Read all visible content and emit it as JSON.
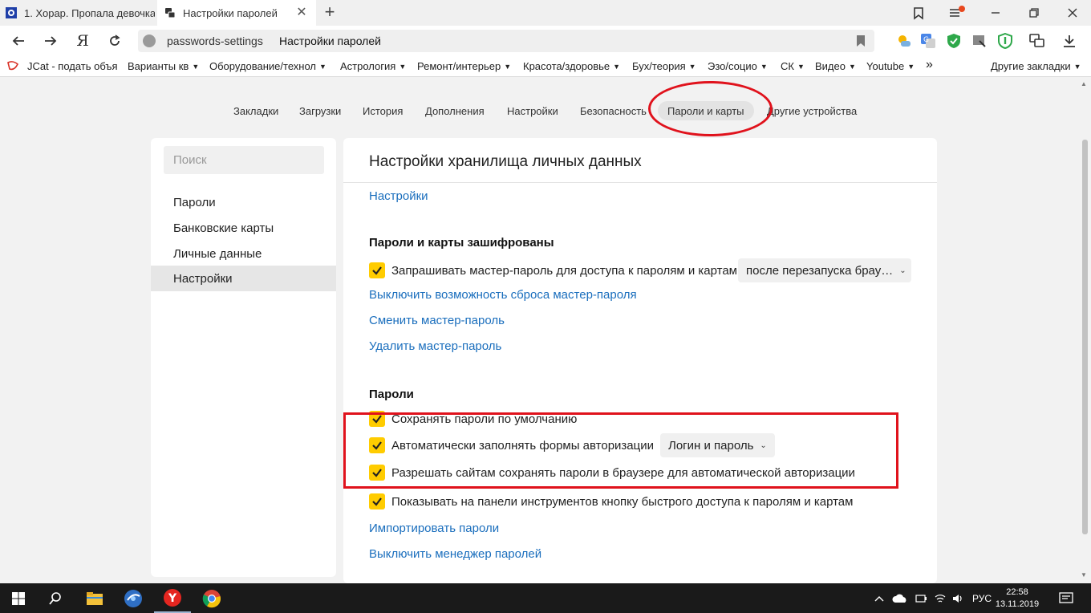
{
  "tabs": [
    {
      "title": "1. Хорар. Пропала девочка",
      "active": false
    },
    {
      "title": "Настройки паролей",
      "active": true
    }
  ],
  "address": {
    "url": "passwords-settings",
    "page_title": "Настройки паролей"
  },
  "bookmarks": [
    {
      "label": "JCat - подать объя",
      "has_menu": false
    },
    {
      "label": "Варианты кв",
      "has_menu": true
    },
    {
      "label": "Оборудование/технол",
      "has_menu": true
    },
    {
      "label": "Астрология",
      "has_menu": true
    },
    {
      "label": "Ремонт/интерьер",
      "has_menu": true
    },
    {
      "label": "Красота/здоровье",
      "has_menu": true
    },
    {
      "label": "Бух/теория",
      "has_menu": true
    },
    {
      "label": "Эзо/социо",
      "has_menu": true
    },
    {
      "label": "СК",
      "has_menu": true
    },
    {
      "label": "Видео",
      "has_menu": true
    },
    {
      "label": "Youtube",
      "has_menu": true
    }
  ],
  "bookmarks_more": "»",
  "other_bookmarks": "Другие закладки",
  "settings_nav": [
    "Закладки",
    "Загрузки",
    "История",
    "Дополнения",
    "Настройки",
    "Безопасность",
    "Пароли и карты",
    "Другие устройства"
  ],
  "settings_nav_active": "Пароли и карты",
  "sidebar": {
    "search_placeholder": "Поиск",
    "items": [
      "Пароли",
      "Банковские карты",
      "Личные данные",
      "Настройки"
    ],
    "selected": "Настройки"
  },
  "main": {
    "title": "Настройки хранилища личных данных",
    "top_link": "Настройки",
    "section_encryption": {
      "title": "Пароли и карты зашифрованы",
      "master_password_label": "Запрашивать мастер-пароль для доступа к паролям и картам",
      "master_password_checked": true,
      "master_password_dropdown": "после перезапуска брау…",
      "links": [
        "Выключить возможность сброса мастер-пароля",
        "Сменить мастер-пароль",
        "Удалить мастер-пароль"
      ]
    },
    "section_passwords": {
      "title": "Пароли",
      "save_by_default": "Сохранять пароли по умолчанию",
      "autofill": "Автоматически заполнять формы авторизации",
      "autofill_dropdown": "Логин и пароль",
      "allow_sites": "Разрешать сайтам сохранять пароли в браузере для автоматической авторизации",
      "toolbar_button": "Показывать на панели инструментов кнопку быстрого доступа к паролям и картам",
      "checked": [
        true,
        true,
        true,
        true
      ],
      "import_link": "Импортировать пароли",
      "disable_link": "Выключить менеджер паролей"
    }
  },
  "taskbar": {
    "language": "РУС",
    "time": "22:58",
    "date": "13.11.2019"
  },
  "colors": {
    "accent": "#ffcc00",
    "link": "#1a6ebd",
    "annotation": "#e0121c"
  }
}
